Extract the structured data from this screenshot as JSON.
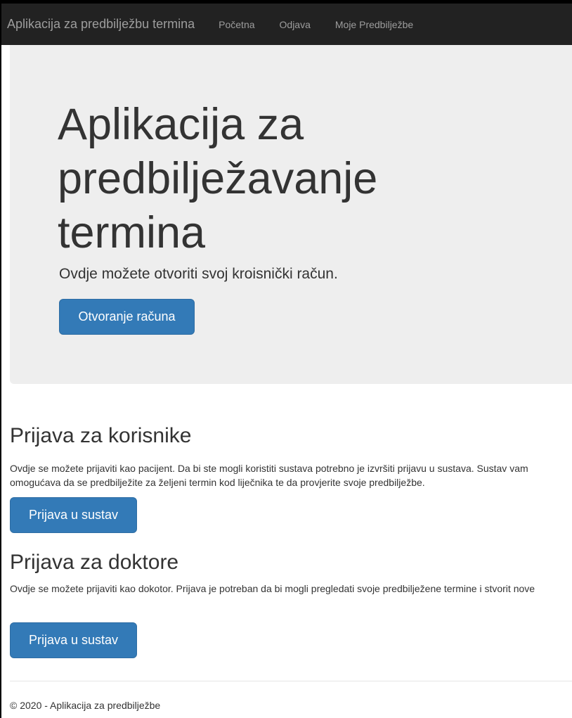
{
  "navbar": {
    "brand": "Aplikacija za predbilježbu termina",
    "links": [
      "Početna",
      "Odjava",
      "Moje Predbilježbe"
    ]
  },
  "jumbotron": {
    "title": "Aplikacija za predbilježavanje termina",
    "lead": "Ovdje možete otvoriti svoj kroisnički račun.",
    "button_label": "Otvoranje računa"
  },
  "sections": [
    {
      "title": "Prijava za korisnike",
      "text": "Ovdje se možete prijaviti kao pacijent. Da bi ste mogli koristiti sustava potrebno je izvršiti prijavu u sustava. Sustav vam omogućava da se predbilježite za željeni termin kod liječnika te da provjerite svoje predbilježbe.",
      "button_label": "Prijava u sustav"
    },
    {
      "title": "Prijava za doktore",
      "text": "Ovdje se možete prijaviti kao dokotor. Prijava je potreban da bi mogli pregledati svoje predbilježene termine i stvorit nove",
      "button_label": "Prijava u sustav"
    }
  ],
  "footer": {
    "text": "© 2020 - Aplikacija za predbilježbe"
  },
  "colors": {
    "navbar_bg": "#222222",
    "nav_text": "#9d9d9d",
    "jumbotron_bg": "#eeeeee",
    "primary_button": "#337ab7"
  }
}
